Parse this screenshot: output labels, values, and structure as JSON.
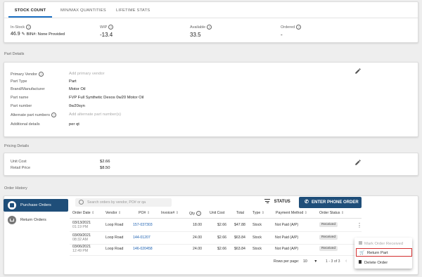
{
  "tabs": [
    "STOCK COUNT",
    "MIN/MAX QUANTITIES",
    "LIFETIME STATS"
  ],
  "stock": {
    "in_stock_label": "In-Stock",
    "in_stock_value": "46.9",
    "bin_text": "BIN#: None Provided",
    "wip_label": "WIP",
    "wip_value": "-13.4",
    "available_label": "Available",
    "available_value": "33.5",
    "ordered_label": "Ordered",
    "ordered_value": "-"
  },
  "part_details": {
    "section_title": "Part Details",
    "rows": [
      {
        "label": "Primary Vendor",
        "value": "Add primary vendor",
        "placeholder": true,
        "help": true
      },
      {
        "label": "Part Type",
        "value": "Part",
        "placeholder": false,
        "help": false
      },
      {
        "label": "Brand/Manufacturer",
        "value": "Motor Oil",
        "placeholder": false,
        "help": false
      },
      {
        "label": "Part name",
        "value": "FVP Full Synthetic Dexos 0w20 Motor Oil",
        "placeholder": false,
        "help": false
      },
      {
        "label": "Part number",
        "value": "0w20syn",
        "placeholder": false,
        "help": false
      },
      {
        "label": "Alternate part numbers",
        "value": "Add alternate part number(s)",
        "placeholder": true,
        "help": true
      },
      {
        "label": "Additional details",
        "value": "per qt",
        "placeholder": false,
        "help": false
      }
    ]
  },
  "pricing": {
    "section_title": "Pricing Details",
    "rows": [
      {
        "label": "Unit Cost",
        "value": "$2.66"
      },
      {
        "label": "Retail Price",
        "value": "$8.50"
      }
    ]
  },
  "order_history": {
    "section_title": "Order History",
    "side_items": [
      "Purchase Orders",
      "Return Orders"
    ],
    "search_placeholder": "Search orders by vendor, PO# or qa",
    "status_label": "STATUS",
    "enter_order_label": "ENTER PHONE ORDER",
    "columns": [
      "Order Date",
      "Vendor",
      "PO#",
      "Invoice#",
      "Qty",
      "Unit Cost",
      "Total",
      "Type",
      "Payment Method",
      "Order Status"
    ],
    "rows": [
      {
        "date": "03/13/2021",
        "time": "01:19 PM",
        "vendor": "Loop Road",
        "po": "157-037303",
        "invoice": "",
        "qty": "18.00",
        "unit_cost": "$2.66",
        "total": "$47.88",
        "type": "Stock",
        "payment": "Not Paid (A/P)",
        "status": "Received"
      },
      {
        "date": "03/09/2021",
        "time": "08:32 AM",
        "vendor": "Loop Road",
        "po": "144-01207",
        "invoice": "",
        "qty": "24.00",
        "unit_cost": "$2.66",
        "total": "$63.84",
        "type": "Stock",
        "payment": "Not Paid (A/P)",
        "status": "Received"
      },
      {
        "date": "03/06/2021",
        "time": "12:49 PM",
        "vendor": "Loop Road",
        "po": "146-020458",
        "invoice": "",
        "qty": "24.00",
        "unit_cost": "$2.66",
        "total": "$63.84",
        "type": "Stock",
        "payment": "Not Paid (A/P)",
        "status": "Received"
      }
    ],
    "rows_per_page_label": "Rows per page:",
    "rows_per_page_value": "10",
    "pagination_text": "1 - 3 of 3"
  },
  "context_menu": {
    "items": [
      "Mark Order Received",
      "Return Part",
      "Delete Order"
    ]
  },
  "colors": {
    "accent": "#1a6fc4",
    "primary_dark": "#1f4e79",
    "link": "#1a5fb0",
    "highlight": "#d32f2f"
  }
}
